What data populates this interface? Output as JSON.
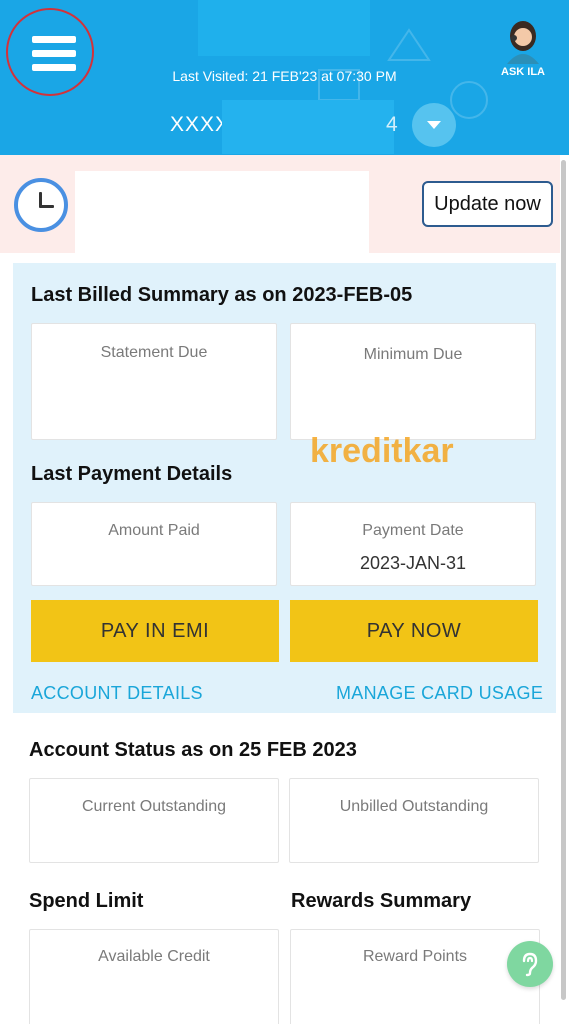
{
  "header": {
    "menu_icon": "hamburger-menu-icon",
    "last_visited": "Last Visited: 21 FEB'23 at 07:30 PM",
    "account_prefix": "XXXX",
    "account_suffix": "4",
    "ask_label": "ASK ILA",
    "ask_icon": "assistant-avatar-icon",
    "dropdown_icon": "chevron-down-icon",
    "bg_color": "#1aa6e6"
  },
  "banner": {
    "icon": "clock-icon",
    "update_label": "Update now",
    "bg_color": "#fdecea"
  },
  "billed": {
    "title": "Last Billed Summary as on 2023-FEB-05",
    "statement_due_label": "Statement Due",
    "minimum_due_label": "Minimum Due",
    "payment_title": "Last Payment Details",
    "amount_paid_label": "Amount Paid",
    "payment_date_label": "Payment Date",
    "payment_date_value": "2023-JAN-31",
    "pay_emi_label": "PAY IN EMI",
    "pay_now_label": "PAY NOW",
    "account_details_link": "ACCOUNT DETAILS",
    "manage_card_link": "MANAGE CARD USAGE",
    "watermark": "kreditkar",
    "button_color": "#f2c416",
    "link_color": "#1aa6d9"
  },
  "account_status": {
    "title": "Account Status as on 25 FEB 2023",
    "current_outstanding_label": "Current Outstanding",
    "unbilled_outstanding_label": "Unbilled Outstanding"
  },
  "spend": {
    "title": "Spend Limit",
    "available_credit_label": "Available Credit"
  },
  "rewards": {
    "title": "Rewards Summary",
    "reward_points_label": "Reward Points"
  },
  "fab": {
    "icon": "hearing-help-icon"
  }
}
